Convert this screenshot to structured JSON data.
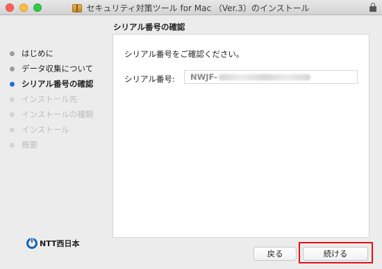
{
  "window": {
    "title": "セキュリティ対策ツール for Mac （Ver.3）のインストール"
  },
  "section_title": "シリアル番号の確認",
  "steps": [
    {
      "label": "はじめに",
      "state": "done"
    },
    {
      "label": "データ収集について",
      "state": "done"
    },
    {
      "label": "シリアル番号の確認",
      "state": "current"
    },
    {
      "label": "インストール先",
      "state": "future"
    },
    {
      "label": "インストールの種類",
      "state": "future"
    },
    {
      "label": "インストール",
      "state": "future"
    },
    {
      "label": "概要",
      "state": "future"
    }
  ],
  "content": {
    "prompt": "シリアル番号をご確認ください。",
    "serial_label": "シリアル番号:",
    "serial_value_visible": "NWJF-"
  },
  "logo": {
    "text": "NTT西日本"
  },
  "buttons": {
    "back": "戻る",
    "continue": "続ける"
  },
  "colors": {
    "accent": "#1d6fd6",
    "highlight": "#e30f16"
  }
}
